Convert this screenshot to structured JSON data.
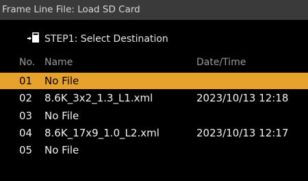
{
  "window": {
    "title": "Frame Line File: Load SD Card"
  },
  "step": {
    "icon": "sd-card-load-icon",
    "label": "STEP1: Select Destination"
  },
  "columns": {
    "no": "No.",
    "name": "Name",
    "datetime": "Date/Time"
  },
  "files": [
    {
      "no": "01",
      "name": "No File",
      "datetime": "",
      "selected": true
    },
    {
      "no": "02",
      "name": "8.6K_3x2_1.3_L1.xml",
      "datetime": "2023/10/13 12:18",
      "selected": false
    },
    {
      "no": "03",
      "name": "No File",
      "datetime": "",
      "selected": false
    },
    {
      "no": "04",
      "name": "8.6K_17x9_1.0_L2.xml",
      "datetime": "2023/10/13 12:17",
      "selected": false
    },
    {
      "no": "05",
      "name": "No File",
      "datetime": "",
      "selected": false
    }
  ],
  "colors": {
    "selection": "#e7a22b",
    "title_bar": "#3a3a3a",
    "background": "#000000"
  }
}
